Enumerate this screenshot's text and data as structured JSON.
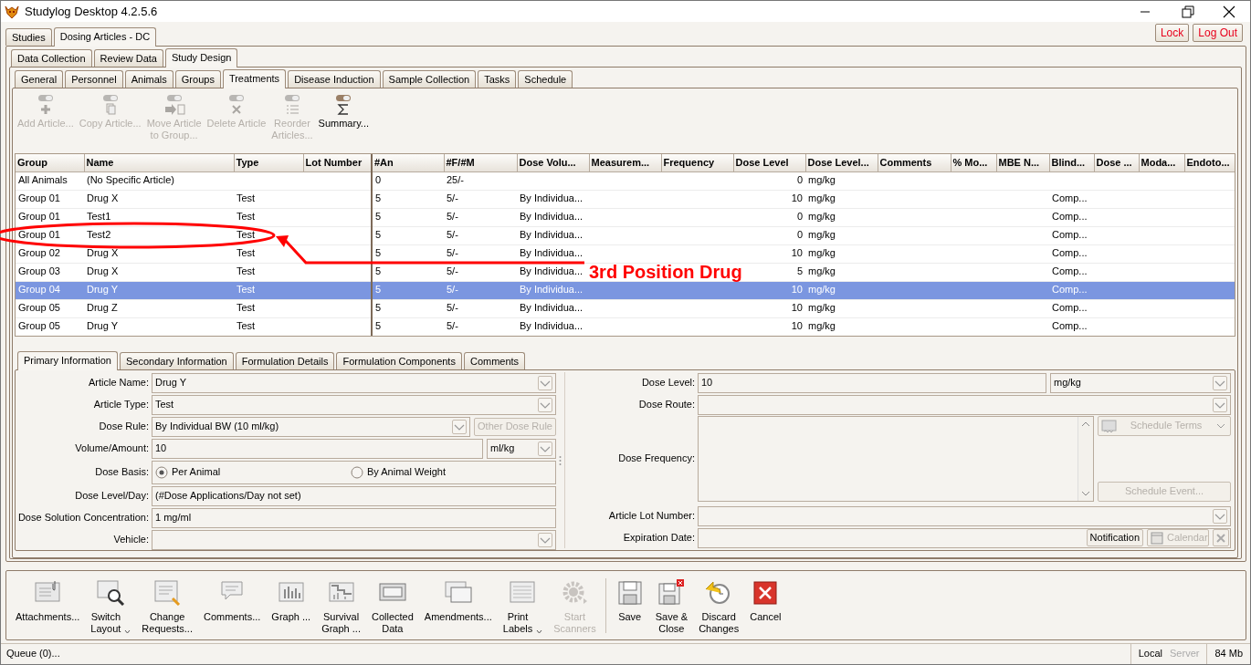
{
  "window": {
    "title": "Studylog Desktop 4.2.5.6"
  },
  "top_tabs": [
    {
      "label": "Studies",
      "selected": false
    },
    {
      "label": "Dosing Articles - DC",
      "selected": true
    }
  ],
  "session_buttons": [
    {
      "label": "Lock"
    },
    {
      "label": "Log Out"
    }
  ],
  "mode_tabs": [
    {
      "label": "Data Collection",
      "selected": false
    },
    {
      "label": "Review Data",
      "selected": false
    },
    {
      "label": "Study Design",
      "selected": true
    }
  ],
  "design_tabs": [
    {
      "label": "General",
      "selected": false
    },
    {
      "label": "Personnel",
      "selected": false
    },
    {
      "label": "Animals",
      "selected": false
    },
    {
      "label": "Groups",
      "selected": false
    },
    {
      "label": "Treatments",
      "selected": true
    },
    {
      "label": "Disease Induction",
      "selected": false
    },
    {
      "label": "Sample Collection",
      "selected": false
    },
    {
      "label": "Tasks",
      "selected": false
    },
    {
      "label": "Schedule",
      "selected": false
    }
  ],
  "article_toolbar": [
    {
      "label": "Add Article...",
      "disabled": true
    },
    {
      "label": "Copy Article...",
      "disabled": true
    },
    {
      "label": "Move Article\nto Group...",
      "disabled": true
    },
    {
      "label": "Delete Article",
      "disabled": true
    },
    {
      "label": "Reorder\nArticles...",
      "disabled": true
    },
    {
      "label": "Summary...",
      "disabled": false
    }
  ],
  "table": {
    "columns": [
      "Group",
      "Name",
      "Type",
      "Lot Number",
      "#An",
      "#F/#M",
      "Dose Volu...",
      "Measurem...",
      "Frequency",
      "Dose Level",
      "Dose Level...",
      "Comments",
      "% Mo...",
      "MBE N...",
      "Blind...",
      "Dose ...",
      "Moda...",
      "Endoto..."
    ],
    "rows": [
      {
        "selected": false,
        "group": "All Animals",
        "name": "(No Specific Article)",
        "an": "0",
        "fm": "25/-",
        "dose_level": "0",
        "dose_level_unit": "mg/kg"
      },
      {
        "selected": false,
        "group": "Group 01",
        "name": "Drug X",
        "type": "Test",
        "an": "5",
        "fm": "5/-",
        "dose_volume": "By Individua...",
        "dose_level": "10",
        "dose_level_unit": "mg/kg",
        "blinding": "Comp..."
      },
      {
        "selected": false,
        "group": "Group 01",
        "name": "Test1",
        "type": "Test",
        "an": "5",
        "fm": "5/-",
        "dose_volume": "By Individua...",
        "dose_level": "0",
        "dose_level_unit": "mg/kg",
        "blinding": "Comp..."
      },
      {
        "selected": false,
        "group": "Group 01",
        "name": "Test2",
        "type": "Test",
        "an": "5",
        "fm": "5/-",
        "dose_volume": "By Individua...",
        "dose_level": "0",
        "dose_level_unit": "mg/kg",
        "blinding": "Comp..."
      },
      {
        "selected": false,
        "group": "Group 02",
        "name": "Drug X",
        "type": "Test",
        "an": "5",
        "fm": "5/-",
        "dose_volume": "By Individua...",
        "dose_level": "10",
        "dose_level_unit": "mg/kg",
        "blinding": "Comp..."
      },
      {
        "selected": false,
        "group": "Group 03",
        "name": "Drug X",
        "type": "Test",
        "an": "5",
        "fm": "5/-",
        "dose_volume": "By Individua...",
        "dose_level": "5",
        "dose_level_unit": "mg/kg",
        "blinding": "Comp..."
      },
      {
        "selected": true,
        "group": "Group 04",
        "name": "Drug Y",
        "type": "Test",
        "an": "5",
        "fm": "5/-",
        "dose_volume": "By Individua...",
        "dose_level": "10",
        "dose_level_unit": "mg/kg",
        "blinding": "Comp..."
      },
      {
        "selected": false,
        "group": "Group 05",
        "name": "Drug Z",
        "type": "Test",
        "an": "5",
        "fm": "5/-",
        "dose_volume": "By Individua...",
        "dose_level": "10",
        "dose_level_unit": "mg/kg",
        "blinding": "Comp..."
      },
      {
        "selected": false,
        "group": "Group 05",
        "name": "Drug Y",
        "type": "Test",
        "an": "5",
        "fm": "5/-",
        "dose_volume": "By Individua...",
        "dose_level": "10",
        "dose_level_unit": "mg/kg",
        "blinding": "Comp..."
      }
    ]
  },
  "annotation": {
    "text": "3rd Position Drug"
  },
  "detail_tabs": [
    {
      "label": "Primary Information",
      "selected": true
    },
    {
      "label": "Secondary Information",
      "selected": false
    },
    {
      "label": "Formulation Details",
      "selected": false
    },
    {
      "label": "Formulation Components",
      "selected": false
    },
    {
      "label": "Comments",
      "selected": false
    }
  ],
  "left_fields": [
    {
      "label": "Article Name:",
      "kind": "combo",
      "value": "Drug Y"
    },
    {
      "label": "Article Type:",
      "kind": "combo",
      "value": "Test"
    },
    {
      "label": "Dose Rule:",
      "kind": "combo",
      "value": "By Individual BW (10 ml/kg)",
      "buttons": [
        {
          "label": "Other Dose Rule",
          "disabled": true
        }
      ]
    },
    {
      "label": "Volume/Amount:",
      "kind": "unit",
      "value": "10",
      "unit": "ml/kg"
    },
    {
      "label": "Dose Basis:",
      "kind": "radios",
      "options": [
        {
          "label": "Per Animal",
          "selected": true
        },
        {
          "label": "By Animal Weight",
          "selected": false
        }
      ]
    },
    {
      "label": "Dose Level/Day:",
      "kind": "text",
      "value": "(#Dose Applications/Day not set)"
    },
    {
      "label": "Dose Solution Concentration:",
      "kind": "text",
      "value": "1 mg/ml"
    },
    {
      "label": "Vehicle:",
      "kind": "combo"
    }
  ],
  "right_fields": [
    {
      "label": "Dose Level:",
      "kind": "unit",
      "value": "10",
      "unit": "mg/kg"
    },
    {
      "label": "Dose Route:",
      "kind": "combo"
    },
    {
      "label": "Dose Frequency:",
      "kind": "memo",
      "buttons": [
        {
          "label": "Schedule Terms",
          "disabled": true
        },
        {
          "label": "Schedule Event...",
          "disabled": true
        }
      ]
    },
    {
      "label": "Article Lot Number:",
      "kind": "combo"
    },
    {
      "label": "Expiration Date:",
      "kind": "date",
      "buttons": [
        {
          "label": "Notification",
          "disabled": false
        },
        {
          "label": "Calendar",
          "disabled": true
        }
      ]
    }
  ],
  "bottom_toolbar": [
    {
      "label": "Attachments...",
      "disabled": false,
      "dropdown": false
    },
    {
      "label": "Switch\nLayout",
      "disabled": false,
      "dropdown": true
    },
    {
      "label": "Change\nRequests...",
      "disabled": false,
      "dropdown": false
    },
    {
      "label": "Comments...",
      "disabled": false,
      "dropdown": false
    },
    {
      "label": "Graph ...",
      "disabled": false,
      "dropdown": false
    },
    {
      "label": "Survival\nGraph ...",
      "disabled": false,
      "dropdown": false
    },
    {
      "label": "Collected\nData",
      "disabled": false,
      "dropdown": false
    },
    {
      "label": "Amendments...",
      "disabled": false,
      "dropdown": false
    },
    {
      "label": "Print\nLabels",
      "disabled": false,
      "dropdown": true
    },
    {
      "label": "Start\nScanners",
      "disabled": true,
      "dropdown": false
    },
    {
      "label": "Save",
      "disabled": false,
      "dropdown": false
    },
    {
      "label": "Save &\nClose",
      "disabled": false,
      "dropdown": false
    },
    {
      "label": "Discard\nChanges",
      "disabled": false,
      "dropdown": false
    },
    {
      "label": "Cancel",
      "disabled": false,
      "dropdown": false
    }
  ],
  "status_bar": {
    "text": "Queue (0)...",
    "modes": [
      {
        "label": "Local",
        "active": true
      },
      {
        "label": "Server",
        "active": false
      }
    ],
    "memory": "84 Mb"
  }
}
